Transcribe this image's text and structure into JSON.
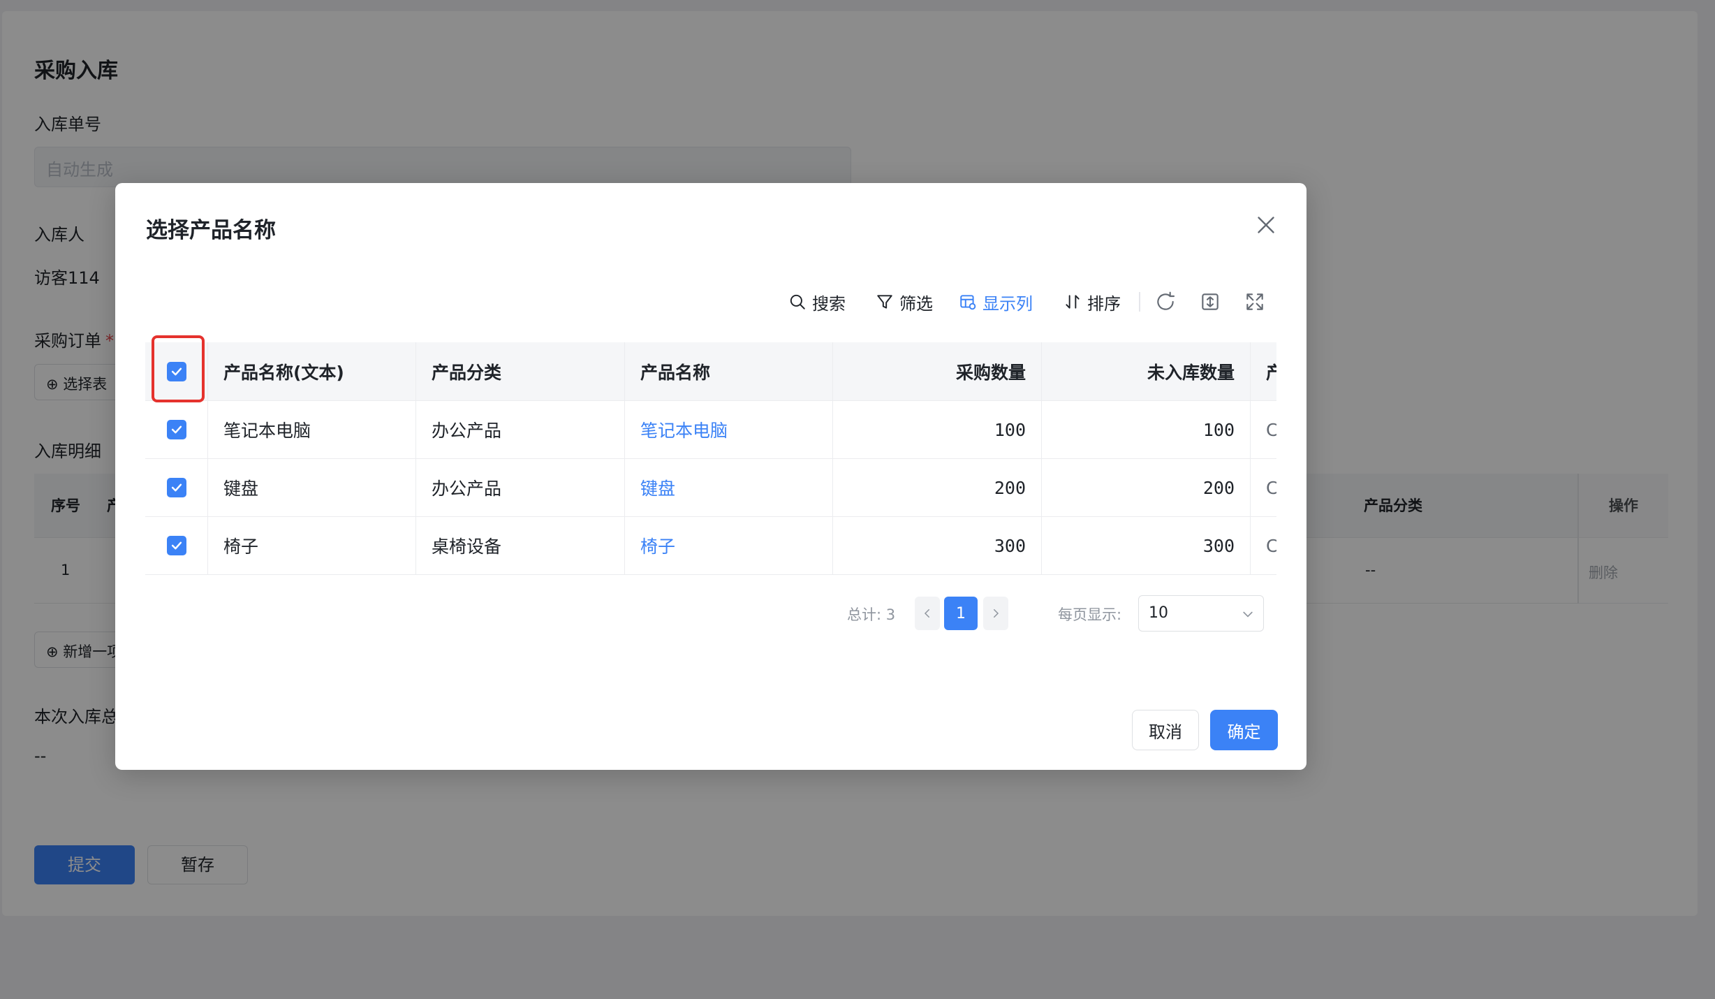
{
  "background": {
    "page_title": "采购入库",
    "receipt_no_label": "入库单号",
    "receipt_no_placeholder": "自动生成",
    "receiver_label": "入库人",
    "receiver_value": "访客114",
    "purchase_order_label": "采购订单",
    "required_mark": "*",
    "select_form_button": "⊕ 选择表",
    "details_label": "入库明细",
    "table_headers": {
      "index": "序号",
      "product": "产",
      "category": "产品分类",
      "operation": "操作"
    },
    "row": {
      "index": "1",
      "category": "--",
      "delete": "删除"
    },
    "add_item_button": "⊕ 新增一项",
    "total_label": "本次入库总",
    "total_value": "--",
    "submit_button": "提交",
    "draft_button": "暂存"
  },
  "modal": {
    "title": "选择产品名称",
    "toolbar": {
      "search": "搜索",
      "filter": "筛选",
      "columns": "显示列",
      "sort": "排序"
    },
    "columns": [
      "产品名称(文本)",
      "产品分类",
      "产品名称",
      "采购数量",
      "未入库数量",
      "产"
    ],
    "rows": [
      {
        "name_text": "笔记本电脑",
        "category": "办公产品",
        "name": "笔记本电脑",
        "qty": "100",
        "not_received": "100",
        "extra": "C"
      },
      {
        "name_text": "键盘",
        "category": "办公产品",
        "name": "键盘",
        "qty": "200",
        "not_received": "200",
        "extra": "C"
      },
      {
        "name_text": "椅子",
        "category": "桌椅设备",
        "name": "椅子",
        "qty": "300",
        "not_received": "300",
        "extra": "C"
      }
    ],
    "pagination": {
      "total": "总计: 3",
      "current_page": "1",
      "page_size_label": "每页显示:",
      "page_size": "10"
    },
    "cancel_button": "取消",
    "confirm_button": "确定"
  },
  "colors": {
    "accent": "#3b82f6",
    "highlight": "#e5322d",
    "overlay": "rgba(0,0,0,0.45)"
  }
}
